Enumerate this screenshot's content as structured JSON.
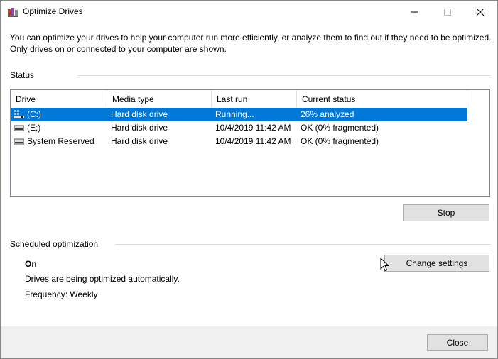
{
  "window": {
    "title": "Optimize Drives",
    "icons": {
      "app": "defrag-app-icon",
      "minimize": "minimize-icon",
      "maximize": "maximize-icon",
      "close": "close-icon"
    }
  },
  "description": "You can optimize your drives to help your computer run more efficiently, or analyze them to find out if they need to be optimized. Only drives on or connected to your computer are shown.",
  "status": {
    "label": "Status",
    "columns": [
      "Drive",
      "Media type",
      "Last run",
      "Current status"
    ],
    "drives": [
      {
        "drive": "(C:)",
        "icon": "windows-drive-icon",
        "media_type": "Hard disk drive",
        "last_run": "Running...",
        "current_status": "26% analyzed",
        "selected": true
      },
      {
        "drive": "(E:)",
        "icon": "hard-drive-icon",
        "media_type": "Hard disk drive",
        "last_run": "10/4/2019 11:42 AM",
        "current_status": "OK (0% fragmented)",
        "selected": false
      },
      {
        "drive": "System Reserved",
        "icon": "hard-drive-icon",
        "media_type": "Hard disk drive",
        "last_run": "10/4/2019 11:42 AM",
        "current_status": "OK (0% fragmented)",
        "selected": false
      }
    ],
    "stop_button": "Stop"
  },
  "scheduled": {
    "label": "Scheduled optimization",
    "state": "On",
    "message": "Drives are being optimized automatically.",
    "frequency": "Frequency: Weekly",
    "change_button": "Change settings"
  },
  "footer": {
    "close_button": "Close"
  },
  "colors": {
    "selection": "#0078d7",
    "button_face": "#e1e1e1",
    "footer_bg": "#f0f0f0"
  }
}
